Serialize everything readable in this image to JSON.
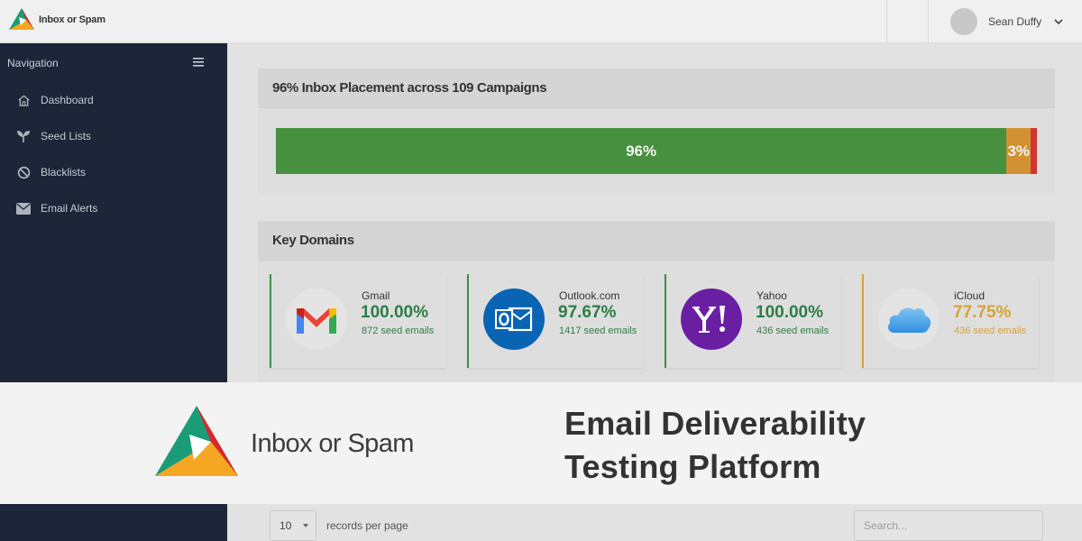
{
  "topbar": {
    "brand": "Inbox or Spam",
    "user_name": "Sean Duffy"
  },
  "sidebar": {
    "heading": "Navigation",
    "items": [
      {
        "label": "Dashboard",
        "icon": "home-icon"
      },
      {
        "label": "Seed Lists",
        "icon": "sprout-icon"
      },
      {
        "label": "Blacklists",
        "icon": "ban-icon"
      },
      {
        "label": "Email Alerts",
        "icon": "envelope-icon"
      }
    ]
  },
  "placement": {
    "title": "96% Inbox Placement across 109 Campaigns",
    "segments": [
      {
        "label": "96%",
        "value": 96,
        "color": "#46903f"
      },
      {
        "label": "3%",
        "value": 3.2,
        "color": "#d29233"
      },
      {
        "label": "",
        "value": 0.8,
        "color": "#cf3535"
      }
    ]
  },
  "key_domains": {
    "title": "Key Domains",
    "domains": [
      {
        "name": "Gmail",
        "percent": "100.00%",
        "seeds": "872 seed emails",
        "status": "good",
        "icon": "gmail-icon"
      },
      {
        "name": "Outlook.com",
        "percent": "97.67%",
        "seeds": "1417 seed emails",
        "status": "good",
        "icon": "outlook-icon"
      },
      {
        "name": "Yahoo",
        "percent": "100.00%",
        "seeds": "436 seed emails",
        "status": "good",
        "icon": "yahoo-icon"
      },
      {
        "name": "iCloud",
        "percent": "77.75%",
        "seeds": "436 seed emails",
        "status": "warn",
        "icon": "icloud-icon"
      }
    ]
  },
  "banner": {
    "brand": "Inbox or Spam",
    "tagline_line1": "Email Deliverability",
    "tagline_line2": "Testing Platform"
  },
  "table_controls": {
    "page_size": "10",
    "records_label": "records per page",
    "search_placeholder": "Search..."
  },
  "colors": {
    "sidebar_bg": "#1c2638",
    "good": "#2e7d46",
    "warn": "#d9a336"
  }
}
